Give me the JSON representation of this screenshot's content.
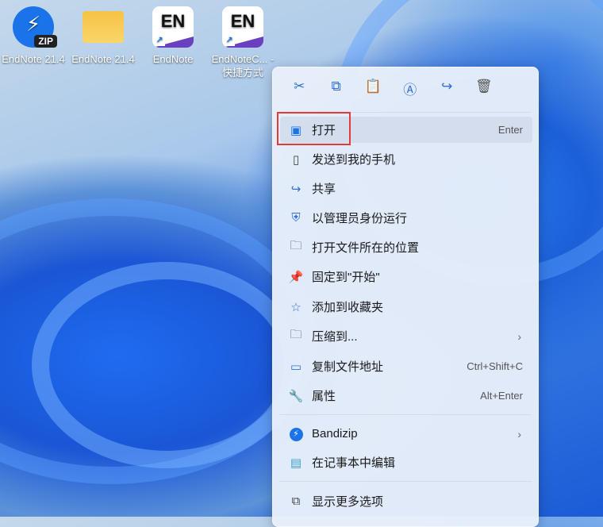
{
  "desktop": {
    "icons": [
      {
        "label": "EndNote 21.4",
        "type": "zip"
      },
      {
        "label": "EndNote 21.4",
        "type": "folder"
      },
      {
        "label": "EndNote",
        "type": "en",
        "badge": "EN"
      },
      {
        "label": "EndNoteC... - 快捷方式",
        "type": "en",
        "badge": "EN"
      }
    ]
  },
  "menu": {
    "toolbar": [
      "cut",
      "copy",
      "paste",
      "rename",
      "share",
      "delete"
    ],
    "items": [
      {
        "label": "打开",
        "shortcut": "Enter",
        "icon": "open-icon"
      },
      {
        "label": "发送到我的手机",
        "icon": "phone-icon"
      },
      {
        "label": "共享",
        "icon": "share-icon"
      },
      {
        "label": "以管理员身份运行",
        "icon": "shield-icon"
      },
      {
        "label": "打开文件所在的位置",
        "icon": "folder-icon"
      },
      {
        "label": "固定到\"开始\"",
        "icon": "pin-icon"
      },
      {
        "label": "添加到收藏夹",
        "icon": "star-icon"
      },
      {
        "label": "压缩到...",
        "icon": "zip-icon"
      },
      {
        "label": "复制文件地址",
        "shortcut": "Ctrl+Shift+C",
        "icon": "path-icon"
      },
      {
        "label": "属性",
        "shortcut": "Alt+Enter",
        "icon": "wrench-icon"
      },
      {
        "label": "Bandizip",
        "icon": "bandizip-icon"
      },
      {
        "label": "在记事本中编辑",
        "icon": "notepad-icon"
      },
      {
        "label": "显示更多选项",
        "icon": "more-options-icon"
      }
    ]
  },
  "colors": {
    "accent": "#2f6fd6",
    "highlight": "#e53935"
  }
}
